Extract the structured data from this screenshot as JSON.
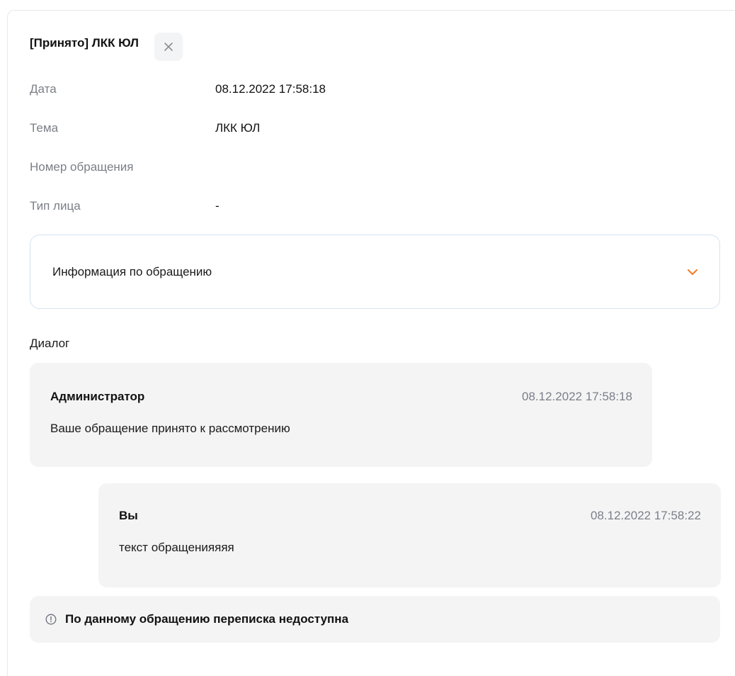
{
  "header": {
    "title": "[Принято] ЛКК ЮЛ",
    "close_icon": "close-icon"
  },
  "fields": [
    {
      "label": "Дата",
      "value": "08.12.2022 17:58:18"
    },
    {
      "label": "Тема",
      "value": "ЛКК ЮЛ"
    },
    {
      "label": "Номер обращения",
      "value": ""
    },
    {
      "label": "Тип лица",
      "value": "-"
    }
  ],
  "accordion": {
    "label": "Информация по обращению",
    "icon": "chevron-down-icon",
    "icon_color": "#f07a23"
  },
  "dialog": {
    "title": "Диалог",
    "messages": [
      {
        "author": "Администратор",
        "time": "08.12.2022 17:58:18",
        "text": "Ваше обращение принято к рассмотрению"
      },
      {
        "author": "Вы",
        "time": "08.12.2022 17:58:22",
        "text": "текст обращенияяяя"
      }
    ]
  },
  "notice": {
    "icon": "info-circle-icon",
    "text": "По данному обращению переписка недоступна"
  },
  "colors": {
    "accent": "#f07a23",
    "muted_text": "#7a7f87",
    "bubble_bg": "#f4f4f5",
    "accordion_border": "#d6e2f0"
  }
}
